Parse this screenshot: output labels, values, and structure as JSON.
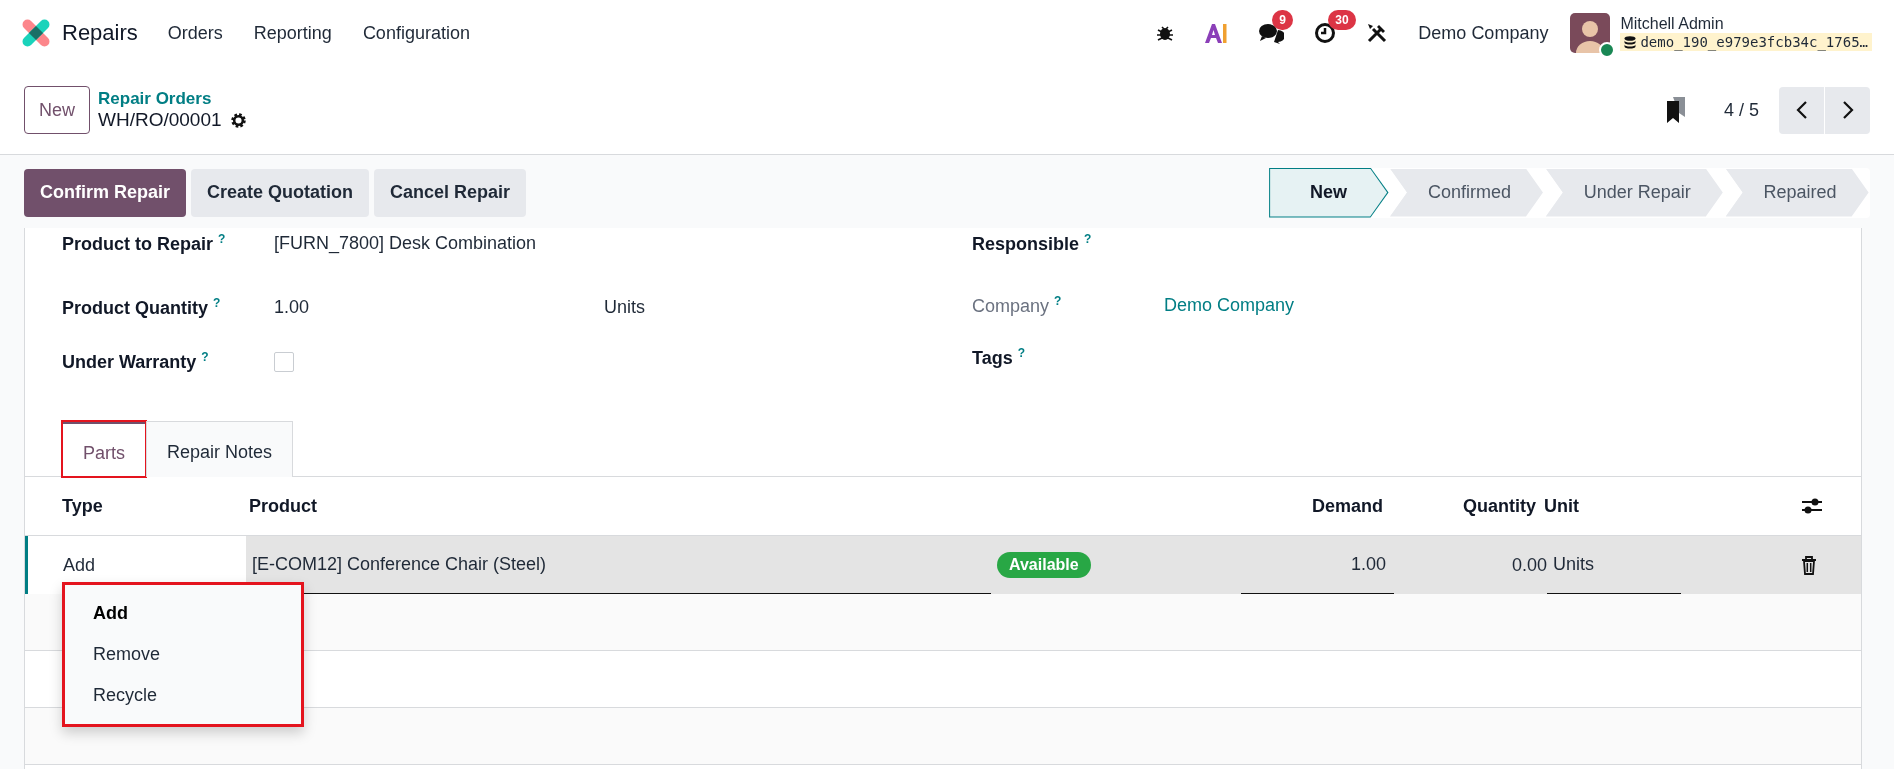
{
  "navbar": {
    "app": "Repairs",
    "menus": [
      "Orders",
      "Reporting",
      "Configuration"
    ],
    "chat_count": "9",
    "activity_count": "30",
    "company": "Demo Company",
    "user": {
      "name": "Mitchell Admin",
      "database": "demo_190_e979e3fcb34c_1765…",
      "online": true
    }
  },
  "control_panel": {
    "new_button": "New",
    "breadcrumb": "Repair Orders",
    "record": "WH/RO/00001",
    "pager": "4 / 5"
  },
  "actions": [
    {
      "label": "Confirm Repair",
      "primary": true
    },
    {
      "label": "Create Quotation",
      "primary": false
    },
    {
      "label": "Cancel Repair",
      "primary": false
    }
  ],
  "status_steps": [
    {
      "label": "New",
      "selected": true
    },
    {
      "label": "Confirmed",
      "selected": false
    },
    {
      "label": "Under Repair",
      "selected": false
    },
    {
      "label": "Repaired",
      "selected": false
    }
  ],
  "fields_left": [
    {
      "label": "Product to Repair",
      "help": "?",
      "kind": "text",
      "value": "[FURN_7800] Desk Combination"
    },
    {
      "label": "Product Quantity",
      "help": "?",
      "kind": "quantity",
      "value": "1.00",
      "unit": "Units"
    },
    {
      "label": "Under Warranty",
      "help": "?",
      "kind": "checkbox",
      "checked": false
    }
  ],
  "fields_right": [
    {
      "label": "Responsible",
      "help": "?",
      "kind": "text",
      "muted": false
    },
    {
      "label": "Company",
      "help": "?",
      "kind": "link",
      "value": "Demo Company",
      "muted": true
    },
    {
      "label": "Tags",
      "help": "?",
      "kind": "text",
      "muted": false
    }
  ],
  "tabs": [
    {
      "label": "Parts",
      "selected": true,
      "highlighted": true
    },
    {
      "label": "Repair Notes",
      "selected": false,
      "highlighted": false
    }
  ],
  "parts": {
    "columns": [
      "Type",
      "Product",
      "Demand",
      "Quantity",
      "Unit"
    ],
    "rows": [
      {
        "type": "Add",
        "product": "[E-COM12] Conference Chair (Steel)",
        "status": "Available",
        "demand": "1.00",
        "quantity": "0.00",
        "unit": "Units",
        "selected": true
      }
    ]
  },
  "type_menu": {
    "highlighted": true,
    "options": [
      {
        "label": "Add",
        "selected": true
      },
      {
        "label": "Remove",
        "selected": false
      },
      {
        "label": "Recycle",
        "selected": false
      }
    ]
  }
}
